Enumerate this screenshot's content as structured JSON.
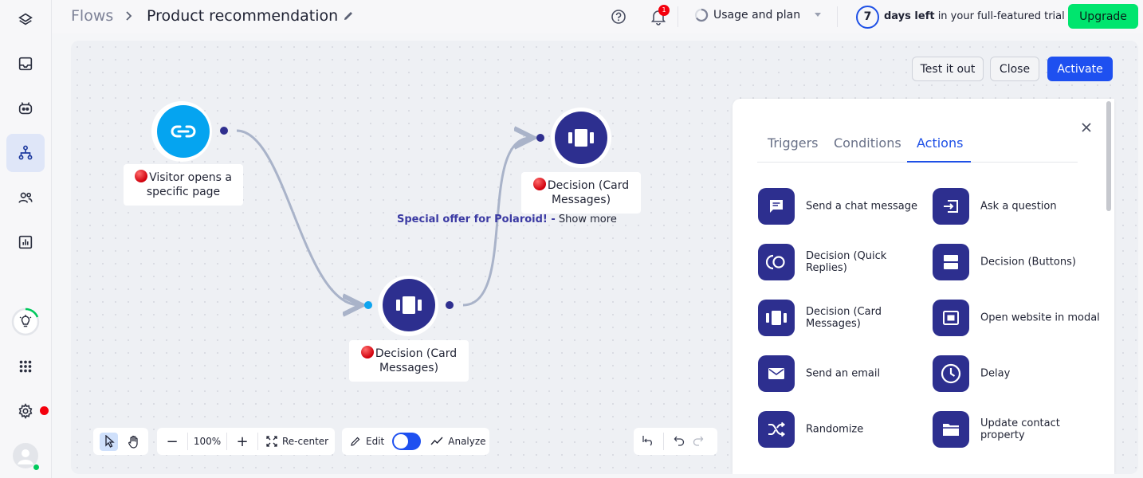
{
  "sidebar": {
    "items": [
      {
        "name": "dashboard",
        "icon": "layers-icon"
      },
      {
        "name": "inbox",
        "icon": "inbox-icon"
      },
      {
        "name": "bots",
        "icon": "bot-icon"
      },
      {
        "name": "flows",
        "icon": "flow-tree-icon",
        "active": true
      },
      {
        "name": "contacts",
        "icon": "users-icon"
      },
      {
        "name": "analytics",
        "icon": "chart-icon"
      }
    ],
    "bottom": [
      {
        "name": "onboarding",
        "icon": "lightbulb-icon"
      },
      {
        "name": "apps",
        "icon": "grid-icon"
      },
      {
        "name": "settings",
        "icon": "gear-icon"
      },
      {
        "name": "account",
        "icon": "avatar-icon"
      }
    ]
  },
  "header": {
    "breadcrumb_root": "Flows",
    "breadcrumb_current": "Product recommendation",
    "notifications_count": "1",
    "usage_label": "Usage and plan",
    "trial_days": "7",
    "trial_bold": "days left",
    "trial_rest": " in your full-featured trial",
    "upgrade_label": "Upgrade"
  },
  "canvas": {
    "test_label": "Test it out",
    "close_label": "Close",
    "activate_label": "Activate",
    "nodes": [
      {
        "label": "Visitor opens a specific page",
        "icon": "link-icon"
      },
      {
        "label": "Decision (Card Messages)",
        "icon": "cards-icon"
      },
      {
        "label": "Decision (Card Messages)",
        "icon": "cards-icon"
      }
    ],
    "edge_label_highlight": "Special offer for Polaroid! -",
    "edge_label_rest": " Show more",
    "toolbar": {
      "zoom": "100%",
      "recenter_label": "Re-center",
      "edit_label": "Edit",
      "analyze_label": "Analyze"
    }
  },
  "panel": {
    "tabs": [
      "Triggers",
      "Conditions",
      "Actions"
    ],
    "active_tab": "Actions",
    "actions": [
      {
        "label": "Send a chat message",
        "icon": "chat-icon"
      },
      {
        "label": "Ask a question",
        "icon": "question-input-icon"
      },
      {
        "label": "Decision (Quick Replies)",
        "icon": "quick-replies-icon"
      },
      {
        "label": "Decision (Buttons)",
        "icon": "buttons-icon"
      },
      {
        "label": "Decision (Card Messages)",
        "icon": "cards-icon"
      },
      {
        "label": "Open website in modal",
        "icon": "modal-icon"
      },
      {
        "label": "Send an email",
        "icon": "email-icon"
      },
      {
        "label": "Delay",
        "icon": "clock-icon"
      },
      {
        "label": "Randomize",
        "icon": "shuffle-icon"
      },
      {
        "label": "Update contact property",
        "icon": "folder-icon"
      }
    ]
  },
  "colors": {
    "accent": "#1e50e6",
    "node_dark": "#2d2f8f",
    "node_trigger": "#05a4f0",
    "upgrade": "#00e56e",
    "alert": "#f4000d"
  }
}
